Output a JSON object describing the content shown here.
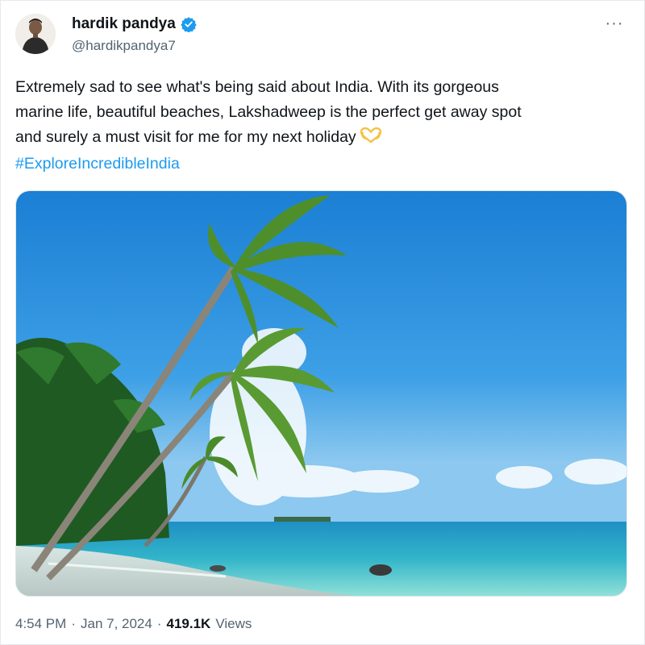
{
  "author": {
    "display_name": "hardik pandya",
    "handle": "@hardikpandya7",
    "verified_icon": "verified-badge-icon",
    "accent_color": "#1d9bf0"
  },
  "more_menu": {
    "label": "···"
  },
  "tweet": {
    "lines": [
      "Extremely sad to see what's being said about India. With its gorgeous",
      "marine life, beautiful beaches, Lakshadweep is the perfect get away spot",
      "and surely a must visit for me for my next holiday"
    ],
    "emoji_icon": "heart-hands-icon",
    "hashtag": "#ExploreIncredibleIndia"
  },
  "media": {
    "icon": "beach-photo"
  },
  "meta": {
    "time": "4:54 PM",
    "separator": "·",
    "date": "Jan 7, 2024",
    "views_count": "419.1K",
    "views_label": "Views"
  }
}
